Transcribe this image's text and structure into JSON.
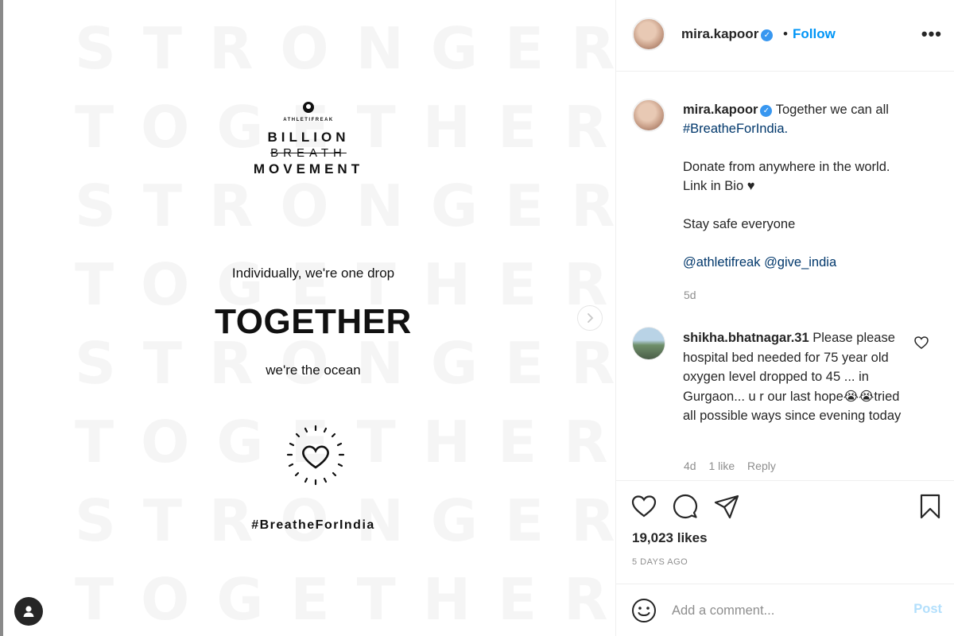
{
  "post_media": {
    "background_words": [
      "STRONGER",
      "TOGETHER",
      "STRONGER",
      "TOGETHER",
      "STRONGER",
      "TOGETHER",
      "STRONGER",
      "TOGETHER"
    ],
    "brand_small": "ATHLETIFREAK",
    "brand_line_1": "BILLION",
    "brand_line_2": "BREATH",
    "brand_line_3": "MOVEMENT",
    "drop_line": "Individually, we're one drop",
    "together_line": "TOGETHER",
    "ocean_line": "we're the ocean",
    "hashtag_line": "#BreatheForIndia",
    "next_icon": "chevron-right-icon",
    "user_icon": "user-icon"
  },
  "header": {
    "username": "mira.kapoor",
    "dot": "•",
    "follow_label": "Follow",
    "more_label": "•••"
  },
  "caption": {
    "username": "mira.kapoor",
    "line_1": "Together we can all",
    "hashtag": "#BreatheForIndia.",
    "line_2": "Donate from anywhere in the world.",
    "line_3": "Link in Bio ♥",
    "line_4": "Stay safe everyone",
    "mention_1": "@athletifreak",
    "mention_2": "@give_india",
    "time": "5d"
  },
  "comment": {
    "username": "shikha.bhatnagar.31",
    "text": "Please please hospital bed needed for 75 year old oxygen level dropped to 45 ... in Gurgaon... u r our last hope😭😭tried all possible ways since evening today",
    "time": "4d",
    "likes": "1 like",
    "reply_label": "Reply"
  },
  "actions": {
    "likes_count": "19,023 likes",
    "posted_ago": "5 DAYS AGO"
  },
  "add_comment": {
    "placeholder": "Add a comment...",
    "post_label": "Post"
  },
  "colors": {
    "accent": "#0095f6",
    "verified": "#3897f0",
    "post_disabled": "#b2dffc",
    "muted": "#8e8e8e"
  }
}
